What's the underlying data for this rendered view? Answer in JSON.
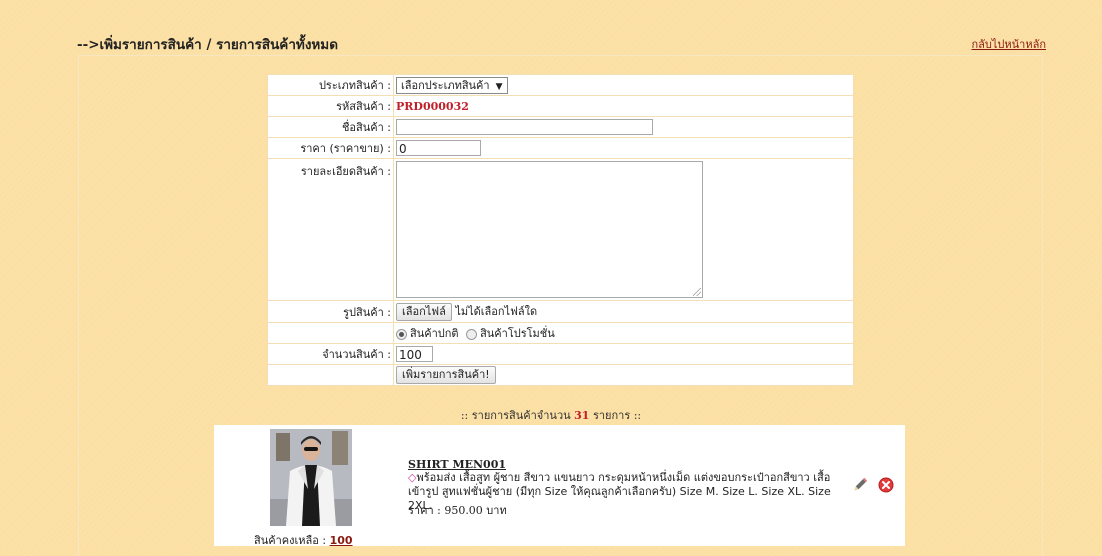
{
  "header": {
    "title": "-->เพิ่มรายการสินค้า / รายการสินค้าทั้งหมด",
    "home_link": "กลับไปหน้าหลัก"
  },
  "form": {
    "category_label": "ประเภทสินค้า :",
    "category_value": "เลือกประเภทสินค้า",
    "code_label": "รหัสสินค้า :",
    "code_value": "PRD000032",
    "name_label": "ชื่อสินค้า :",
    "name_value": "",
    "price_label": "ราคา (ราคาขาย) :",
    "price_value": "0",
    "detail_label": "รายละเอียดสินค้า :",
    "image_label": "รูปสินค้า :",
    "file_button": "เลือกไฟล์",
    "file_status": "ไม่ได้เลือกไฟล์ใด",
    "type_normal": "สินค้าปกติ",
    "type_promo": "สินค้าโปรโมชั่น",
    "type_selected": "สินค้าปกติ",
    "qty_label": "จำนวนสินค้า :",
    "qty_value": "100",
    "submit": "เพิ่มรายการสินค้า!"
  },
  "list": {
    "prefix": ":: รายการสินค้าจำนวน",
    "count": "31",
    "suffix": "รายการ ::"
  },
  "products": [
    {
      "name": "SHIRT MEN001",
      "description": "พร้อมส่ง เสื้อสูท ผู้ชาย สีขาว แขนยาว กระดุมหน้าหนึ่งเม็ด แต่งขอบกระเป๋าอกสีขาว เสื้อเข้ารูป สูทแฟชั่นผู้ชาย (มีทุก Size ให้คุณลูกค้าเลือกครับ) Size M. Size L. Size XL. Size 2XL.",
      "price": "ราคา : 950.00 บาท",
      "stock_label": "สินค้าคงเหลือ :",
      "stock": "100"
    }
  ],
  "colors": {
    "background": "#fbdfa3",
    "accent_red": "#c0202a",
    "link": "#8a1a10"
  }
}
